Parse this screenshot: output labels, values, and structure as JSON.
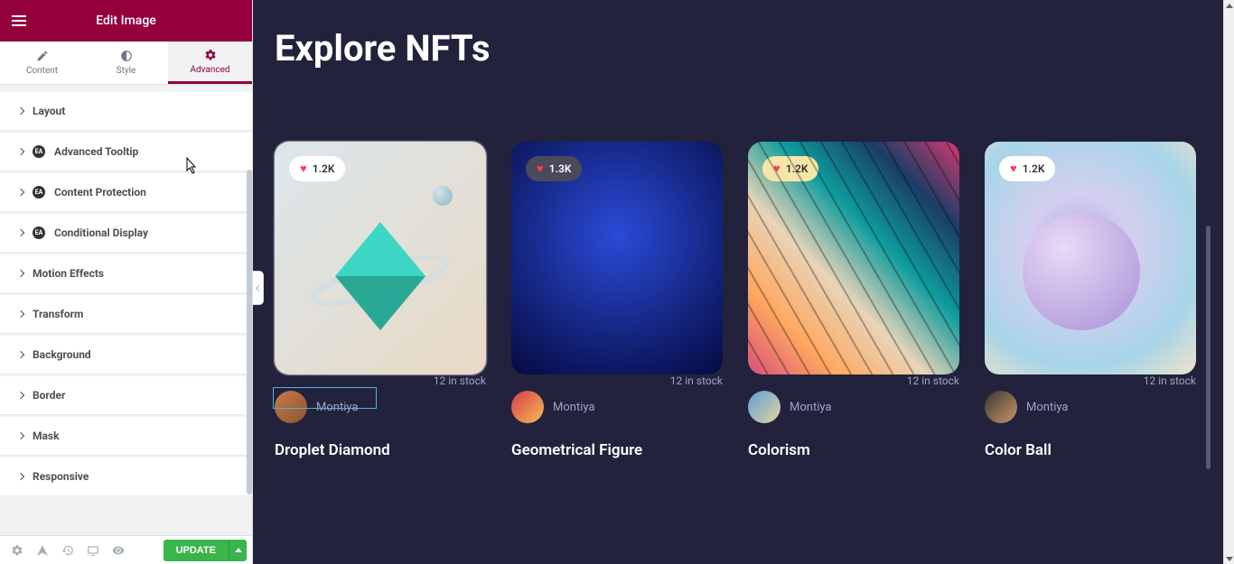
{
  "header": {
    "title": "Edit Image"
  },
  "tabs": {
    "content": "Content",
    "style": "Style",
    "advanced": "Advanced"
  },
  "accordions": [
    {
      "label": "Layout",
      "ea": false
    },
    {
      "label": "Advanced Tooltip",
      "ea": true
    },
    {
      "label": "Content Protection",
      "ea": true
    },
    {
      "label": "Conditional Display",
      "ea": true
    },
    {
      "label": "Motion Effects",
      "ea": false
    },
    {
      "label": "Transform",
      "ea": false
    },
    {
      "label": "Background",
      "ea": false
    },
    {
      "label": "Border",
      "ea": false
    },
    {
      "label": "Mask",
      "ea": false
    },
    {
      "label": "Responsive",
      "ea": false
    }
  ],
  "update_label": "UPDATE",
  "page": {
    "title": "Explore NFTs"
  },
  "cards": [
    {
      "likes": "1.2K",
      "author": "Montiya",
      "stock": "12 in stock",
      "title": "Droplet Diamond",
      "pill_class": "",
      "selected": true
    },
    {
      "likes": "1.3K",
      "author": "Montiya",
      "stock": "12 in stock",
      "title": "Geometrical Figure",
      "pill_class": "dark",
      "selected": false
    },
    {
      "likes": "1.2K",
      "author": "Montiya",
      "stock": "12 in stock",
      "title": "Colorism",
      "pill_class": "yellow",
      "selected": false
    },
    {
      "likes": "1.2K",
      "author": "Montiya",
      "stock": "12 in stock",
      "title": "Color Ball",
      "pill_class": "",
      "selected": false
    }
  ],
  "colors": {
    "brand": "#93003c",
    "canvas_bg": "#22223c",
    "accent_green": "#39b54a"
  }
}
